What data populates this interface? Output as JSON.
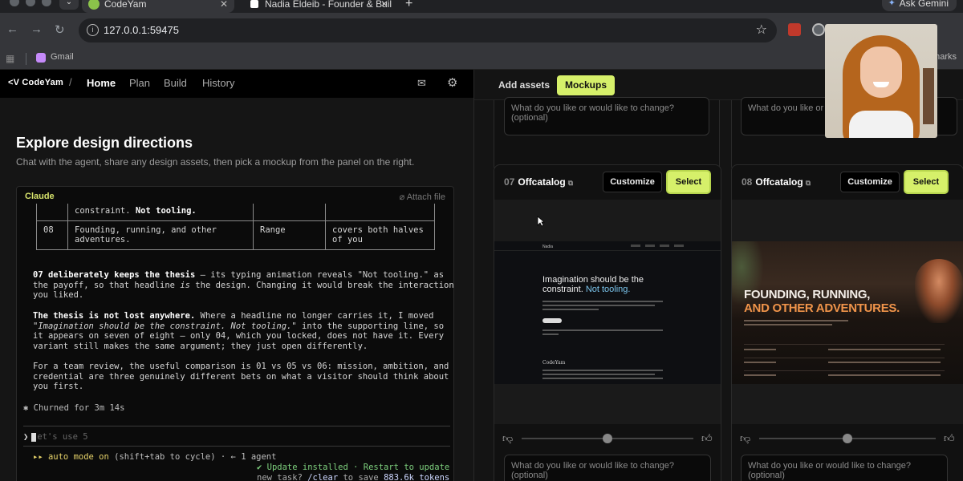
{
  "browser": {
    "tabs": [
      {
        "title": "CodeYam",
        "active": true
      },
      {
        "title": "Nadia Eldeib - Founder & Buil",
        "active": false
      }
    ],
    "new_tab": "+",
    "ask_gemini": "Ask Gemini",
    "url": "127.0.0.1:59475",
    "bookmarks": [
      {
        "label": "Gmail"
      }
    ],
    "all_bookmarks_label": "marks"
  },
  "app": {
    "logo": "<V CodeYam",
    "separator": "/",
    "nav": [
      "Home",
      "Plan",
      "Build",
      "History"
    ],
    "active_nav": "Home"
  },
  "left": {
    "title": "Explore design directions",
    "subtitle": "Chat with the agent, share any design assets, then pick a mockup from the panel on the right.",
    "chat": {
      "agent": "Claude",
      "attach": "Attach file",
      "table_rows": [
        {
          "num": "",
          "variant": "constraint. Not tooling.",
          "lens": "",
          "note": ""
        },
        {
          "num": "08",
          "variant": "Founding, running, and other adventures.",
          "lens": "Range",
          "note": "covers both halves of you"
        }
      ],
      "p1_bold": "07 deliberately keeps the thesis",
      "p1_a": " — its typing animation reveals \"Not tooling.\" as the payoff, so that headline ",
      "p1_em": "is",
      "p1_b": " the design. Changing it would break the interaction you liked.",
      "p2_bold": "The thesis is not lost anywhere.",
      "p2_a": " Where a headline no longer carries it, I moved ",
      "p2_em": "\"Imagination should be the constraint. Not tooling.\"",
      "p2_b": " into the supporting line, so it appears on seven of eight — only 04, which you locked, does not have it. Every variant still makes the same argument; they just open differently.",
      "p3": "For a team review, the useful comparison is 01 vs 05 vs 06: mission, ambition, and credential are three genuinely different bets on what a visitor should think about you first.",
      "churned": "✱ Churned for 3m 14s",
      "prompt_symbol": "❯",
      "prompt_placeholder": "et's use 5",
      "auto_mode": "▸▸ auto mode on",
      "auto_hint": " (shift+tab to cycle) · ← 1 agent",
      "update": "✔ Update installed · Restart to update",
      "new_task_a": "new task? ",
      "new_task_cmd": "/clear",
      "new_task_b": " to save ",
      "new_task_tokens": "883.6k tokens"
    }
  },
  "right": {
    "tabs": [
      "Add assets",
      "Mockups"
    ],
    "active_tab": "Mockups",
    "feedback_placeholder": "What do you like or would like to change? (optional)",
    "feedback_placeholder_short": "What do you like or w",
    "cards": [
      {
        "num": "07",
        "name": "Offcatalog",
        "customize": "Customize",
        "select": "Select",
        "preview": {
          "brand": "Nadia",
          "headline_a": "Imagination should be the",
          "headline_b": "constraint. ",
          "headline_accent": "Not tooling.",
          "footer_brand": "CodeYam"
        },
        "slider_value": 0.5
      },
      {
        "num": "08",
        "name": "Offcatalog",
        "customize": "Customize",
        "select": "Select",
        "preview": {
          "headline_a": "FOUNDING, RUNNING,",
          "headline_b": "AND OTHER ",
          "headline_accent": "ADVENTURES."
        },
        "slider_value": 0.5
      }
    ]
  },
  "colors": {
    "accent": "#d6f06a",
    "agent_label": "#d7e36c",
    "link_blue": "#7cc6ee",
    "orange": "#f0944a"
  }
}
